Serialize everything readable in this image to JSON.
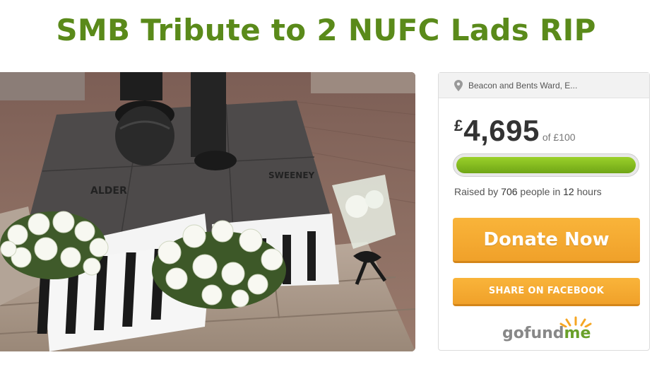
{
  "page": {
    "title": "SMB Tribute to 2 NUFC Lads RIP"
  },
  "campaign": {
    "location": "Beacon and Bents Ward, E...",
    "currency_symbol": "£",
    "amount_raised": "4,695",
    "goal_text": "of £100",
    "progress_fraction": 1.0,
    "raised_prefix": "Raised by",
    "people_count": "706",
    "people_suffix": "people in",
    "time_value": "12",
    "time_unit": "hours"
  },
  "actions": {
    "donate_label": "Donate Now",
    "share_label": "SHARE ON FACEBOOK"
  },
  "brand": {
    "logo_part1": "go",
    "logo_part2": "fund",
    "logo_part3": "me",
    "accent_color": "#5a8a1a",
    "button_color": "#f5a623"
  },
  "image": {
    "shirt_name_left": "ALDER",
    "shirt_name_right": "SWEENEY"
  }
}
